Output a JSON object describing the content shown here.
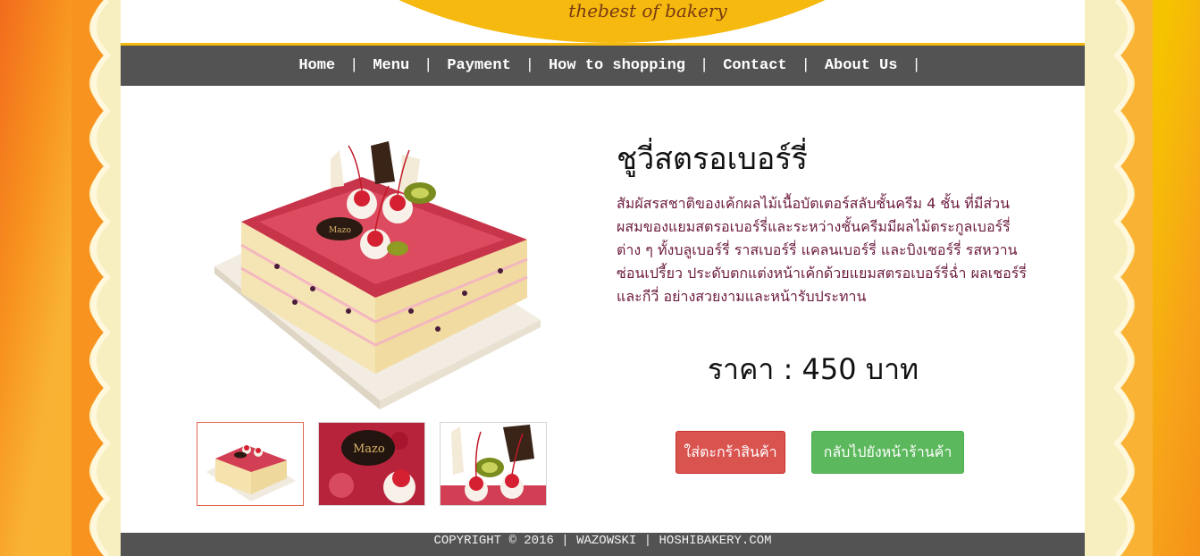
{
  "header": {
    "tagline": "thebest of bakery"
  },
  "nav": {
    "items": [
      {
        "label": "Home"
      },
      {
        "label": "Menu"
      },
      {
        "label": "Payment"
      },
      {
        "label": "How to shopping"
      },
      {
        "label": "Contact"
      },
      {
        "label": "About Us"
      }
    ],
    "separator": "|"
  },
  "product": {
    "title": "ชูวี่สตรอเบอร์รี่",
    "description": "สัมผัสรสชาติของเค้กผลไม้เนื้อบัตเตอร์สลับชั้นครีม 4 ชั้น ที่มีส่วนผสมของแยมสตรอเบอร์รี่และระหว่างชั้นครีมมีผลไม้ตระกูลเบอร์รี่ต่าง ๆ ทั้งบลูเบอร์รี่ ราสเบอร์รี่ แคลนเบอร์รี่ และบิงเชอร์รี่ รสหวานซ่อนเปรี้ยว ประดับตกแต่งหน้าเค้กด้วยแยมสตรอเบอร์รี่ฉ่ำ ผลเชอร์รี่ และกีวี่ อย่างสวยงามและหน้ารับประทาน",
    "price": "ราคา : 450 บาท",
    "thumbnails": [
      "cake-whole",
      "cake-top-closeup",
      "cake-cherries-closeup"
    ],
    "selected_thumbnail": 0
  },
  "actions": {
    "add_to_cart": "ใส่ตะกร้าสินค้า",
    "back_to_shop": "กลับไปยังหน้าร้านค้า"
  },
  "footer": {
    "text": "COPYRIGHT © 2016 | WAZOWSKI | HOSHIBAKERY.COM"
  },
  "colors": {
    "navbar": "#535353",
    "accent_yellow": "#f5b90f",
    "description_text": "#6b1a3e",
    "cart_button": "#d9534f",
    "back_button": "#5cb85c"
  }
}
